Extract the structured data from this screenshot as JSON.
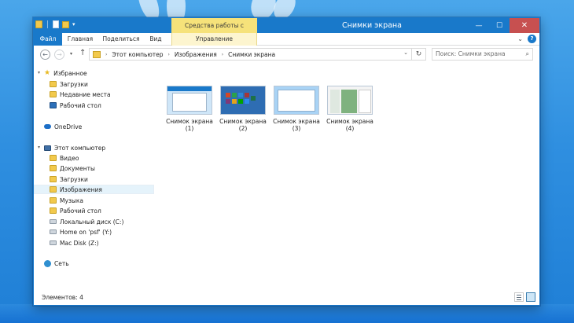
{
  "window": {
    "title": "Снимки экрана",
    "tools_header": "Средства работы с рисунками",
    "buttons": {
      "minimize": "—",
      "maximize": "☐",
      "close": "✕"
    }
  },
  "ribbon": {
    "tabs": [
      {
        "label": "Файл"
      },
      {
        "label": "Главная"
      },
      {
        "label": "Поделиться"
      },
      {
        "label": "Вид"
      },
      {
        "label": "Управление"
      }
    ]
  },
  "address": {
    "crumbs": [
      "Этот компьютер",
      "Изображения",
      "Снимки экрана"
    ],
    "search_placeholder": "Поиск: Снимки экрана"
  },
  "navigation": {
    "favorites": {
      "label": "Избранное",
      "items": [
        "Загрузки",
        "Недавние места",
        "Рабочий стол"
      ]
    },
    "onedrive": {
      "label": "OneDrive"
    },
    "computer": {
      "label": "Этот компьютер",
      "items": [
        "Видео",
        "Документы",
        "Загрузки",
        "Изображения",
        "Музыка",
        "Рабочий стол",
        "Локальный диск (C:)",
        "Home on 'psf' (Y:)",
        "Mac Disk (Z:)"
      ],
      "selected": "Изображения"
    },
    "network": {
      "label": "Сеть"
    }
  },
  "files": [
    {
      "line1": "Снимок экрана",
      "line2": "(1)"
    },
    {
      "line1": "Снимок экрана",
      "line2": "(2)"
    },
    {
      "line1": "Снимок экрана",
      "line2": "(3)"
    },
    {
      "line1": "Снимок экрана",
      "line2": "(4)"
    }
  ],
  "status": {
    "text": "Элементов: 4"
  },
  "colors": {
    "accent": "#1979ca",
    "tools": "#f6e27a",
    "close": "#c75050"
  }
}
